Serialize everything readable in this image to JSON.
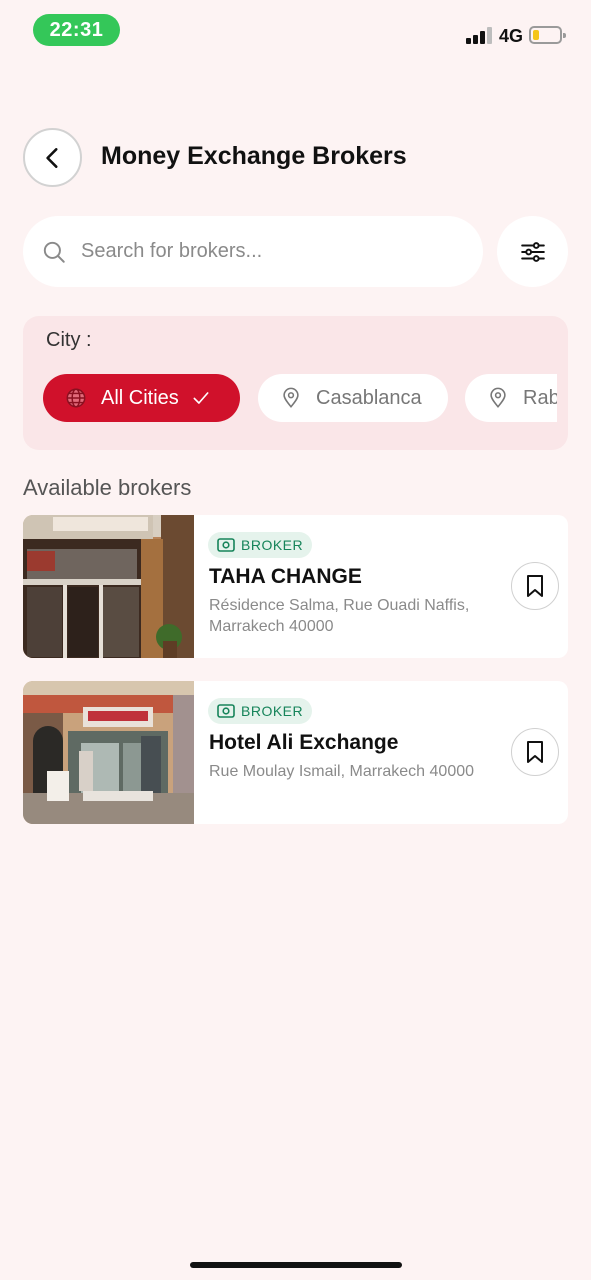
{
  "status_bar": {
    "time": "22:31",
    "network": "4G",
    "battery_level": 0.25,
    "signal_bars": 3,
    "time_pill_color": "#34c759"
  },
  "header": {
    "back_icon": "chevron-left-icon",
    "title": "Money Exchange Brokers"
  },
  "search": {
    "placeholder": "Search for brokers...",
    "value": "",
    "icon": "search-icon",
    "filter_icon": "sliders-icon"
  },
  "city_filter": {
    "label": "City :",
    "chips": [
      {
        "label": "All Cities",
        "icon": "globe-icon",
        "selected": true
      },
      {
        "label": "Casablanca",
        "icon": "map-pin-icon",
        "selected": false
      },
      {
        "label": "Rabat",
        "icon": "map-pin-icon",
        "selected": false
      }
    ]
  },
  "brokers_section": {
    "title": "Available brokers",
    "items": [
      {
        "badge": "BROKER",
        "name": "TAHA CHANGE",
        "address": "Résidence Salma, Rue Ouadi Naffis, Marrakech 40000",
        "bookmark_icon": "bookmark-icon"
      },
      {
        "badge": "BROKER",
        "name": "Hotel Ali Exchange",
        "address": "Rue Moulay Ismail, Marrakech 40000",
        "bookmark_icon": "bookmark-icon"
      }
    ]
  },
  "colors": {
    "background": "#fdf3f3",
    "accent": "#d0112b",
    "city_panel": "#fae6e8",
    "badge_text": "#16845a",
    "badge_bg": "#e5f3ec"
  }
}
